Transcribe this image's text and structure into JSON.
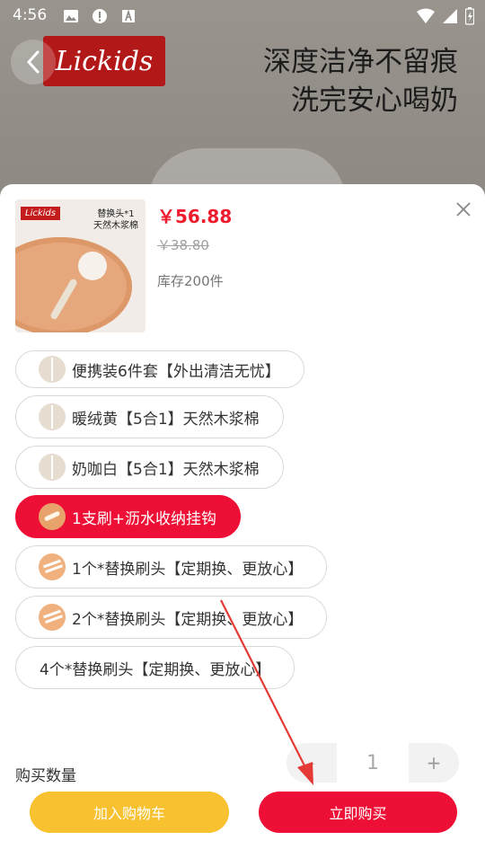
{
  "status_bar": {
    "time": "4:56"
  },
  "banner": {
    "brand": "Lickids",
    "headline_line1": "深度洁净不留痕",
    "headline_line2": "洗完安心喝奶"
  },
  "product": {
    "thumb_brand": "Lickids",
    "thumb_text_line1": "替换头*1",
    "thumb_text_line2": "天然木浆棉",
    "price": "￥56.88",
    "original_price": "￥38.80",
    "stock": "库存200件"
  },
  "options": [
    {
      "label": "便携装6件套【外出清洁无忧】",
      "icon": "brush-set-icon",
      "selected": false
    },
    {
      "label": "暖绒黄【5合1】天然木浆棉",
      "icon": "sponge-yellow-icon",
      "selected": false
    },
    {
      "label": "奶咖白【5合1】天然木浆棉",
      "icon": "sponge-white-icon",
      "selected": false
    },
    {
      "label": "1支刷+沥水收纳挂钩",
      "icon": "brush-hook-icon",
      "selected": true
    },
    {
      "label": "1个*替换刷头【定期换、更放心】",
      "icon": "brush-head-1-icon",
      "selected": false
    },
    {
      "label": "2个*替换刷头【定期换、更放心】",
      "icon": "brush-head-2-icon",
      "selected": false
    },
    {
      "label": "4个*替换刷头【定期换、更放心】",
      "icon": "",
      "selected": false
    }
  ],
  "quantity": {
    "label": "购买数量",
    "minus": "-",
    "value": "1",
    "plus": "+"
  },
  "actions": {
    "add_to_cart": "加入购物车",
    "buy_now": "立即购买"
  },
  "colors": {
    "accent_red": "#ee0f36",
    "cart_yellow": "#f7c12f",
    "annotation_arrow": "#e53935"
  }
}
